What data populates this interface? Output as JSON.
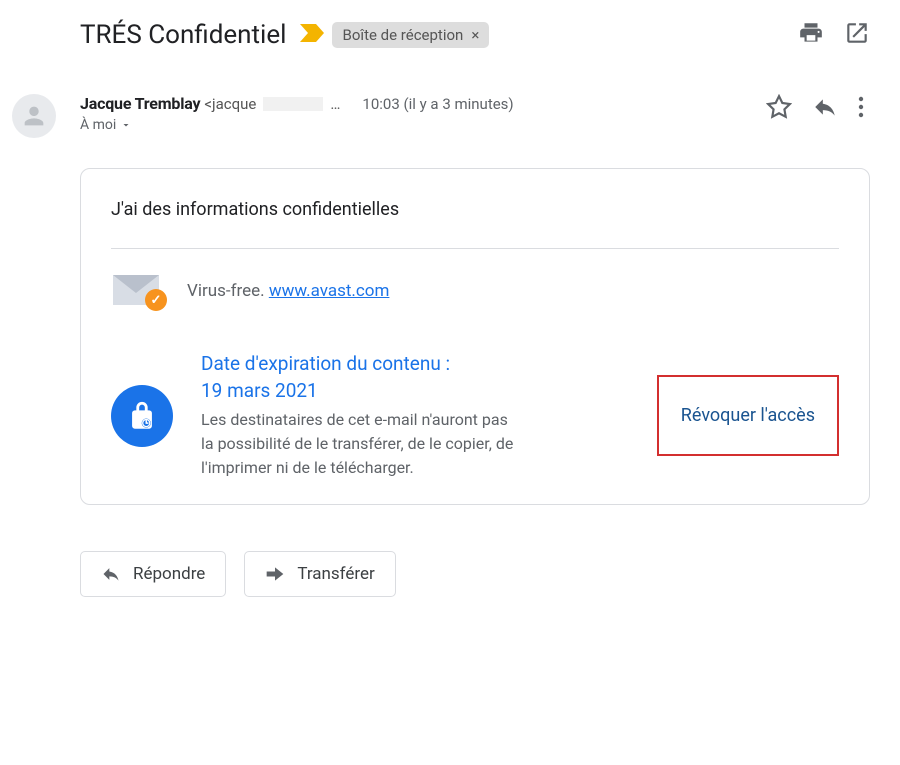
{
  "header": {
    "subject": "TRÉS Confidentiel",
    "label": "Boîte de réception"
  },
  "sender": {
    "name": "Jacque Tremblay",
    "email_prefix": "<jacque",
    "email_suffix": "…",
    "time": "10:03 (il y a 3 minutes)",
    "to_line": "À moi"
  },
  "body": {
    "text": "J'ai des informations confidentielles",
    "virus_label": "Virus-free.",
    "virus_link": "www.avast.com"
  },
  "confidential": {
    "title_line1": "Date d'expiration du contenu :",
    "title_line2": "19 mars 2021",
    "desc": "Les destinataires de cet e-mail n'auront pas la possibilité de le transférer, de le copier, de l'imprimer ni de le télécharger.",
    "revoke": "Révoquer l'accès"
  },
  "actions": {
    "reply": "Répondre",
    "forward": "Transférer"
  }
}
